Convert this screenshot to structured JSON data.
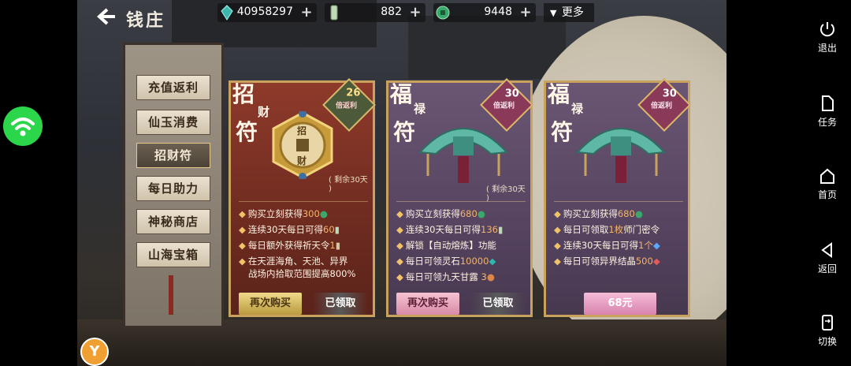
{
  "page": {
    "title": "钱庄"
  },
  "resources": [
    {
      "icon": "jade-gem-icon",
      "value": "40958297"
    },
    {
      "icon": "scroll-token-icon",
      "value": "882"
    },
    {
      "icon": "green-coin-icon",
      "value": "9448"
    }
  ],
  "more_label": "更多",
  "sidebar": {
    "items": [
      {
        "label": "充值返利",
        "active": false
      },
      {
        "label": "仙玉消费",
        "active": false
      },
      {
        "label": "招财符",
        "active": true
      },
      {
        "label": "每日助力",
        "active": false
      },
      {
        "label": "神秘商店",
        "active": false
      },
      {
        "label": "山海宝箱",
        "active": false
      }
    ]
  },
  "cards": [
    {
      "title_big_1": "招",
      "title_small": "财",
      "title_big_2": "符",
      "badge_num": "26",
      "badge_text": "倍返利",
      "coin_text_1": "招",
      "coin_text_2": "财",
      "remaining": "( 剩余30天 )",
      "features": [
        {
          "pre": "购买立刻获得",
          "hl": "300",
          "icon": "green-coin-icon"
        },
        {
          "pre": "连续30天每日可得",
          "hl": "60",
          "icon": "scroll-token-icon"
        },
        {
          "pre": "每日额外获得祈天令",
          "hl": "1",
          "icon": "incense-icon"
        },
        {
          "pre": "在天涯海角、天池、异界",
          "hl": "",
          "icon": ""
        },
        {
          "pre": "战场内拾取范围提高800%",
          "hl": "",
          "icon": ""
        }
      ],
      "btn_rebuy": "再次购买",
      "btn_claimed": "已领取"
    },
    {
      "title_big_1": "福",
      "title_small": "禄",
      "title_big_2": "符",
      "badge_num": "30",
      "badge_text": "倍返利",
      "remaining": "( 剩余30天 )",
      "features": [
        {
          "pre": "购买立刻获得",
          "hl": "680",
          "icon": "green-coin-icon"
        },
        {
          "pre": "连续30天每日可得",
          "hl": "136",
          "icon": "scroll-token-icon"
        },
        {
          "pre": "解锁【自动熔炼】功能",
          "hl": "",
          "icon": ""
        },
        {
          "pre": "每日可领灵石",
          "hl": "10000",
          "icon": "spirit-stone-icon"
        },
        {
          "pre": "每日可领九天甘露 ",
          "hl": "3",
          "icon": "dew-icon"
        }
      ],
      "btn_rebuy": "再次购买",
      "btn_claimed": "已领取"
    },
    {
      "title_big_1": "福",
      "title_small": "禄",
      "title_big_2": "符",
      "badge_num": "30",
      "badge_text": "倍返利",
      "features": [
        {
          "pre": "购买立刻获得",
          "hl": "680",
          "icon": "green-coin-icon"
        },
        {
          "pre": "每日可领取",
          "hl": "1枚",
          "post": "师门密令",
          "icon": ""
        },
        {
          "pre": "连续30天每日可得",
          "hl": "1个",
          "icon": "blue-crystal-icon"
        },
        {
          "pre": "每日可领异界结晶",
          "hl": "500",
          "icon": "red-crystal-icon"
        }
      ],
      "btn_price": "68元"
    }
  ],
  "system_bar": [
    {
      "icon": "power-icon",
      "label": "退出"
    },
    {
      "icon": "document-icon",
      "label": "任务"
    },
    {
      "icon": "home-icon",
      "label": "首页"
    },
    {
      "icon": "back-triangle-icon",
      "label": "返回"
    },
    {
      "icon": "switch-icon",
      "label": "切换"
    }
  ],
  "colors": {
    "red_card": "#8a3324",
    "purple_card": "#5d4a66",
    "rebuy_gold": "#d9c06a",
    "rebuy_pink": "#e7a2b8",
    "price_pink": "#e79cc0",
    "highlight": "#f3b46a",
    "wifi_green": "#2bd64a"
  }
}
